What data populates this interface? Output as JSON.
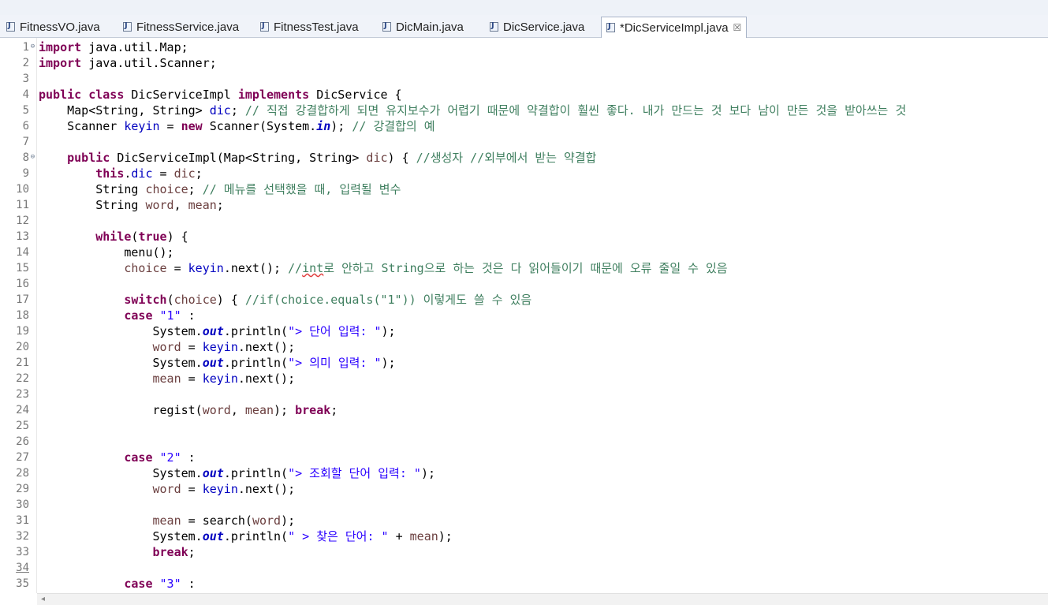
{
  "tabs": [
    {
      "label": "FitnessVO.java",
      "active": false,
      "icon": "java-file-icon"
    },
    {
      "label": "FitnessService.java",
      "active": false,
      "icon": "java-file-icon"
    },
    {
      "label": "FitnessTest.java",
      "active": false,
      "icon": "java-file-icon"
    },
    {
      "label": "DicMain.java",
      "active": false,
      "icon": "java-file-icon"
    },
    {
      "label": "DicService.java",
      "active": false,
      "icon": "java-file-icon"
    },
    {
      "label": "*DicServiceImpl.java",
      "active": true,
      "icon": "java-file-icon",
      "close": "☒"
    }
  ],
  "colors": {
    "keyword": "#7f0055",
    "field": "#0000c0",
    "string": "#2a00ff",
    "comment": "#3f7f5f",
    "variable": "#6a3e3e",
    "line_number": "#787878"
  },
  "editor": {
    "lines": [
      {
        "n": "1",
        "fold": "⊖",
        "tokens": [
          [
            "kw",
            "import"
          ],
          [
            "p",
            " java.util.Map;"
          ]
        ]
      },
      {
        "n": "2",
        "tokens": [
          [
            "kw",
            "import"
          ],
          [
            "p",
            " java.util.Scanner;"
          ]
        ]
      },
      {
        "n": "3",
        "tokens": []
      },
      {
        "n": "4",
        "tokens": [
          [
            "kw",
            "public"
          ],
          [
            "p",
            " "
          ],
          [
            "kw",
            "class"
          ],
          [
            "p",
            " DicServiceImpl "
          ],
          [
            "kw",
            "implements"
          ],
          [
            "p",
            " DicService {"
          ]
        ]
      },
      {
        "n": "5",
        "tokens": [
          [
            "p",
            "    Map<String, String> "
          ],
          [
            "fld",
            "dic"
          ],
          [
            "p",
            "; "
          ],
          [
            "com",
            "// 직접 강결합하게 되면 유지보수가 어렵기 때문에 약결합이 훨씬 좋다. 내가 만드는 것 보다 남이 만든 것을 받아쓰는 것"
          ]
        ]
      },
      {
        "n": "6",
        "tokens": [
          [
            "p",
            "    Scanner "
          ],
          [
            "fld",
            "keyin"
          ],
          [
            "p",
            " = "
          ],
          [
            "kw",
            "new"
          ],
          [
            "p",
            " Scanner(System."
          ],
          [
            "sfld",
            "in"
          ],
          [
            "p",
            "); "
          ],
          [
            "com",
            "// 강결합의 예"
          ]
        ]
      },
      {
        "n": "7",
        "tokens": []
      },
      {
        "n": "8",
        "fold": "⊖",
        "tokens": [
          [
            "p",
            "    "
          ],
          [
            "kw",
            "public"
          ],
          [
            "p",
            " DicServiceImpl(Map<String, String> "
          ],
          [
            "var",
            "dic"
          ],
          [
            "p",
            ") { "
          ],
          [
            "com",
            "//생성자 //외부에서 받는 약결합"
          ]
        ]
      },
      {
        "n": "9",
        "tokens": [
          [
            "p",
            "        "
          ],
          [
            "kw",
            "this"
          ],
          [
            "p",
            "."
          ],
          [
            "fld",
            "dic"
          ],
          [
            "p",
            " = "
          ],
          [
            "var",
            "dic"
          ],
          [
            "p",
            ";"
          ]
        ]
      },
      {
        "n": "10",
        "tokens": [
          [
            "p",
            "        String "
          ],
          [
            "var",
            "choice"
          ],
          [
            "p",
            "; "
          ],
          [
            "com",
            "// 메뉴를 선택했을 때, 입력될 변수"
          ]
        ]
      },
      {
        "n": "11",
        "tokens": [
          [
            "p",
            "        String "
          ],
          [
            "var",
            "word"
          ],
          [
            "p",
            ", "
          ],
          [
            "var",
            "mean"
          ],
          [
            "p",
            ";"
          ]
        ]
      },
      {
        "n": "12",
        "tokens": []
      },
      {
        "n": "13",
        "tokens": [
          [
            "p",
            "        "
          ],
          [
            "kw",
            "while"
          ],
          [
            "p",
            "("
          ],
          [
            "kw",
            "true"
          ],
          [
            "p",
            ") {"
          ]
        ]
      },
      {
        "n": "14",
        "tokens": [
          [
            "p",
            "            menu();"
          ]
        ]
      },
      {
        "n": "15",
        "tokens": [
          [
            "p",
            "            "
          ],
          [
            "var",
            "choice"
          ],
          [
            "p",
            " = "
          ],
          [
            "fld",
            "keyin"
          ],
          [
            "p",
            ".next(); "
          ],
          [
            "com",
            "//"
          ],
          [
            "comsq",
            "int"
          ],
          [
            "com",
            "로 안하고 String으로 하는 것은 다 읽어들이기 때문에 오류 줄일 수 있음"
          ]
        ]
      },
      {
        "n": "16",
        "tokens": []
      },
      {
        "n": "17",
        "tokens": [
          [
            "p",
            "            "
          ],
          [
            "kw",
            "switch"
          ],
          [
            "p",
            "("
          ],
          [
            "var",
            "choice"
          ],
          [
            "p",
            ") { "
          ],
          [
            "com",
            "//if(choice.equals(\"1\")) 이렇게도 쓸 수 있음"
          ]
        ]
      },
      {
        "n": "18",
        "tokens": [
          [
            "p",
            "            "
          ],
          [
            "kw",
            "case"
          ],
          [
            "p",
            " "
          ],
          [
            "str",
            "\"1\""
          ],
          [
            "p",
            " :"
          ]
        ]
      },
      {
        "n": "19",
        "tokens": [
          [
            "p",
            "                System."
          ],
          [
            "sfld",
            "out"
          ],
          [
            "p",
            ".println("
          ],
          [
            "str",
            "\"> 단어 입력: \""
          ],
          [
            "p",
            ");"
          ]
        ]
      },
      {
        "n": "20",
        "tokens": [
          [
            "p",
            "                "
          ],
          [
            "var",
            "word"
          ],
          [
            "p",
            " = "
          ],
          [
            "fld",
            "keyin"
          ],
          [
            "p",
            ".next();"
          ]
        ]
      },
      {
        "n": "21",
        "tokens": [
          [
            "p",
            "                System."
          ],
          [
            "sfld",
            "out"
          ],
          [
            "p",
            ".println("
          ],
          [
            "str",
            "\"> 의미 입력: \""
          ],
          [
            "p",
            ");"
          ]
        ]
      },
      {
        "n": "22",
        "tokens": [
          [
            "p",
            "                "
          ],
          [
            "var",
            "mean"
          ],
          [
            "p",
            " = "
          ],
          [
            "fld",
            "keyin"
          ],
          [
            "p",
            ".next();"
          ]
        ]
      },
      {
        "n": "23",
        "tokens": []
      },
      {
        "n": "24",
        "tokens": [
          [
            "p",
            "                regist("
          ],
          [
            "var",
            "word"
          ],
          [
            "p",
            ", "
          ],
          [
            "var",
            "mean"
          ],
          [
            "p",
            "); "
          ],
          [
            "kw",
            "break"
          ],
          [
            "p",
            ";"
          ]
        ]
      },
      {
        "n": "25",
        "tokens": []
      },
      {
        "n": "26",
        "tokens": []
      },
      {
        "n": "27",
        "tokens": [
          [
            "p",
            "            "
          ],
          [
            "kw",
            "case"
          ],
          [
            "p",
            " "
          ],
          [
            "str",
            "\"2\""
          ],
          [
            "p",
            " :"
          ]
        ]
      },
      {
        "n": "28",
        "tokens": [
          [
            "p",
            "                System."
          ],
          [
            "sfld",
            "out"
          ],
          [
            "p",
            ".println("
          ],
          [
            "str",
            "\"> 조회할 단어 입력: \""
          ],
          [
            "p",
            ");"
          ]
        ]
      },
      {
        "n": "29",
        "tokens": [
          [
            "p",
            "                "
          ],
          [
            "var",
            "word"
          ],
          [
            "p",
            " = "
          ],
          [
            "fld",
            "keyin"
          ],
          [
            "p",
            ".next();"
          ]
        ]
      },
      {
        "n": "30",
        "tokens": []
      },
      {
        "n": "31",
        "tokens": [
          [
            "p",
            "                "
          ],
          [
            "var",
            "mean"
          ],
          [
            "p",
            " = search("
          ],
          [
            "var",
            "word"
          ],
          [
            "p",
            ");"
          ]
        ]
      },
      {
        "n": "32",
        "tokens": [
          [
            "p",
            "                System."
          ],
          [
            "sfld",
            "out"
          ],
          [
            "p",
            ".println("
          ],
          [
            "str",
            "\" > 찾은 단어: \""
          ],
          [
            "p",
            " + "
          ],
          [
            "var",
            "mean"
          ],
          [
            "p",
            ");"
          ]
        ]
      },
      {
        "n": "33",
        "tokens": [
          [
            "p",
            "                "
          ],
          [
            "kw",
            "break"
          ],
          [
            "p",
            ";"
          ]
        ]
      },
      {
        "n": "34",
        "underline": true,
        "tokens": []
      },
      {
        "n": "35",
        "tokens": [
          [
            "p",
            "            "
          ],
          [
            "kw",
            "case"
          ],
          [
            "p",
            " "
          ],
          [
            "str",
            "\"3\""
          ],
          [
            "p",
            " :"
          ]
        ]
      }
    ]
  },
  "scrollbar": {
    "left_arrow": "◂"
  }
}
